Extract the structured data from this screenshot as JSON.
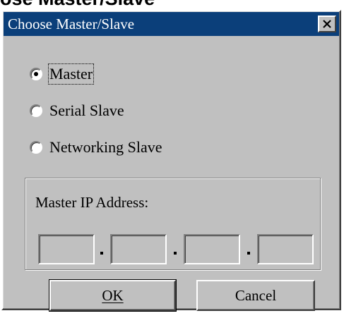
{
  "page": {
    "caption": "ose Master/Slave"
  },
  "dialog": {
    "title": "Choose Master/Slave",
    "close_icon": "close-icon",
    "options": [
      {
        "label": "Master",
        "selected": true
      },
      {
        "label": "Serial Slave",
        "selected": false
      },
      {
        "label": "Networking Slave",
        "selected": false
      }
    ],
    "ip_group": {
      "label": "Master IP Address:",
      "octets": [
        "",
        "",
        "",
        ""
      ]
    },
    "buttons": {
      "ok_label": "OK",
      "cancel_label": "Cancel"
    }
  },
  "colors": {
    "titlebar": "#0b3f7a",
    "face": "#c0c0c0"
  }
}
